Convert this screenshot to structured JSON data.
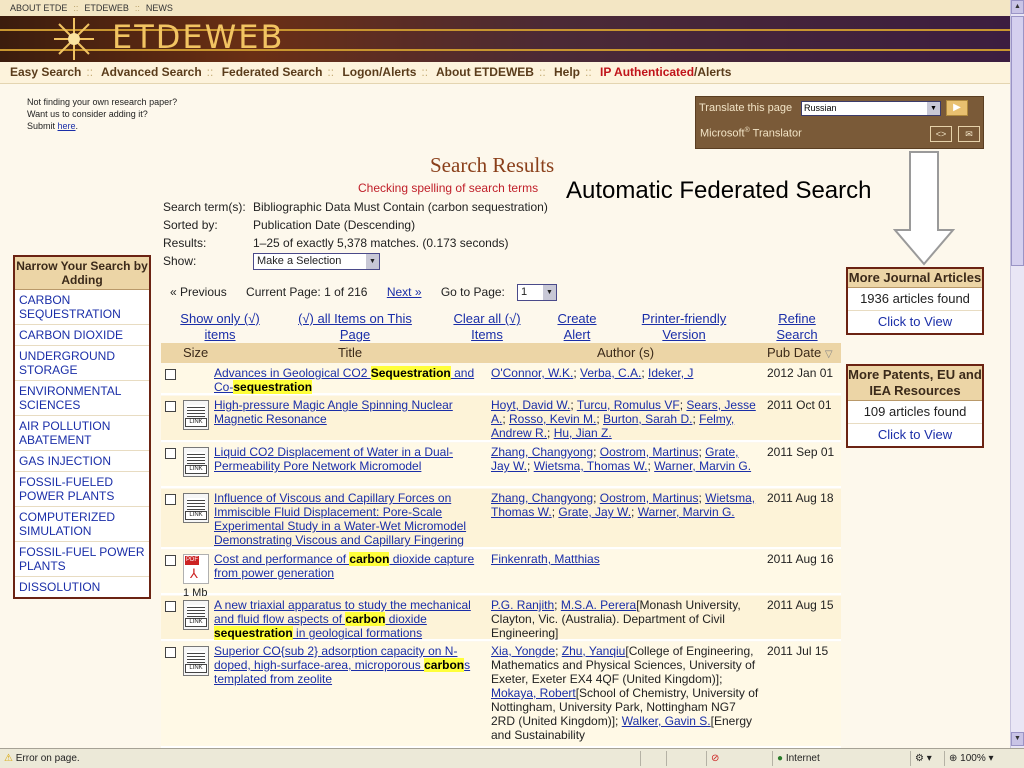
{
  "top_links": [
    "ABOUT ETDE",
    "ETDEWEB",
    "NEWS"
  ],
  "logo": "ETDEWEB",
  "nav": {
    "items": [
      "Easy Search",
      "Advanced Search",
      "Federated Search",
      "Logon/Alerts",
      "About ETDEWEB",
      "Help"
    ],
    "ip_prefix": "IP Authenticated",
    "ip_suffix": "/Alerts"
  },
  "note": {
    "line1": "Not finding your own research paper?",
    "line2": "Want us to consider adding it?",
    "line3_prefix": "Submit ",
    "line3_link": "here",
    "line3_suffix": "."
  },
  "translator": {
    "label": "Translate this page",
    "language": "Russian",
    "provider": "Microsoft",
    "provider_mark": "®",
    "provider_suffix": " Translator",
    "code_icon": "<>",
    "mail_icon": "✉"
  },
  "results_header": {
    "title": "Search Results",
    "spelling": "Checking spelling of search terms",
    "annotation": "Automatic Federated Search"
  },
  "meta": {
    "term_label": "Search term(s):",
    "term_value": "Bibliographic Data Must Contain (carbon sequestration)",
    "sort_label": "Sorted by:",
    "sort_value": "Publication Date (Descending)",
    "results_label": "Results:",
    "results_value": "1–25 of exactly 5,378 matches. (0.173 seconds)",
    "show_label": "Show:",
    "show_value": "Make a Selection"
  },
  "pager": {
    "previous": "« Previous",
    "current": "Current Page: 1 of 216",
    "next": "Next »",
    "goto_label": "Go to Page:",
    "goto_value": "1"
  },
  "actions": {
    "show_only_1": "Show only (√)",
    "show_only_2": "items",
    "all_items_1": "(√) all Items on This",
    "all_items_2": "Page",
    "clear_1": "Clear all (√)",
    "clear_2": "Items",
    "alert_1": "Create",
    "alert_2": "Alert",
    "print_1": "Printer-friendly",
    "print_2": "Version",
    "refine_1": "Refine",
    "refine_2": "Search"
  },
  "table_headers": {
    "size": "Size",
    "title": "Title",
    "author": "Author (s)",
    "date": "Pub Date",
    "sort_icon": "▽"
  },
  "rows": [
    {
      "title_parts": [
        "Advances in Geological CO2 ",
        "Sequestration",
        " and Co-",
        "sequestration"
      ],
      "authors": [
        "O'Connor, W.K.",
        "; ",
        "Verba, C.A.",
        "; ",
        "Ideker, J"
      ],
      "date": "2012 Jan 01"
    },
    {
      "title": "High-pressure Magic Angle Spinning Nuclear Magnetic Resonance",
      "authors": [
        "Hoyt, David W.",
        "; ",
        "Turcu, Romulus VF",
        "; ",
        "Sears, Jesse A.",
        "; ",
        "Rosso, Kevin M.",
        "; ",
        "Burton, Sarah D.",
        "; ",
        "Felmy, Andrew R.",
        "; ",
        "Hu, Jian Z."
      ],
      "date": "2011 Oct 01"
    },
    {
      "title": "Liquid CO2 Displacement of Water in a Dual-Permeability Pore Network Micromodel",
      "authors": [
        "Zhang, Changyong",
        "; ",
        "Oostrom, Martinus",
        "; ",
        "Grate, Jay W.",
        "; ",
        "Wietsma, Thomas W.",
        "; ",
        "Warner, Marvin G."
      ],
      "date": "2011 Sep 01"
    },
    {
      "title": "Influence of Viscous and Capillary Forces on Immiscible Fluid Displacement: Pore-Scale Experimental Study in a Water-Wet Micromodel Demonstrating Viscous and Capillary Fingering",
      "authors": [
        "Zhang, Changyong",
        "; ",
        "Oostrom, Martinus",
        "; ",
        "Wietsma, Thomas W.",
        "; ",
        "Grate, Jay W.",
        "; ",
        "Warner, Marvin G."
      ],
      "date": "2011 Aug 18"
    },
    {
      "title_parts": [
        "Cost and performance of ",
        "carbon",
        " dioxide capture from power generation"
      ],
      "authors": [
        "Finkenrath, Matthias"
      ],
      "date": "2011 Aug 16",
      "size": "1 Mb"
    },
    {
      "title_parts": [
        "A new triaxial apparatus to study the mechanical and fluid flow aspects of ",
        "carbon",
        " dioxide ",
        "sequestration",
        " in geological formations"
      ],
      "author_link_1": "P.G. Ranjith",
      "author_sep": "; ",
      "author_link_2": "M.S.A. Perera",
      "author_affil": "[Monash University, Clayton, Vic. (Australia). Department of Civil Engineering]",
      "date": "2011 Aug 15"
    },
    {
      "title_parts": [
        "Superior CO{sub 2} adsorption capacity on N-doped, high-surface-area, microporous ",
        "carbon",
        "s templated from zeolite"
      ],
      "author_link_1": "Xia, Yongde",
      "author_sep": "; ",
      "author_link_2": "Zhu, Yanqiu",
      "author_affil": "[College of Engineering, Mathematics and Physical Sciences, University of Exeter, Exeter EX4 4QF (United Kingdom)]; ",
      "author_link_3": "Mokaya, Robert",
      "author_affil_2": "[School of Chemistry, University of Nottingham, University Park, Nottingham NG7 2RD (United Kingdom)]; ",
      "author_link_4": "Walker, Gavin S.",
      "author_affil_3": "[Energy and Sustainability",
      "date": "2011 Jul 15"
    }
  ],
  "narrow": {
    "header": "Narrow Your Search by Adding",
    "items": [
      "CARBON SEQUESTRATION",
      "CARBON DIOXIDE",
      "UNDERGROUND STORAGE",
      "ENVIRONMENTAL SCIENCES",
      "AIR POLLUTION ABATEMENT",
      "GAS INJECTION",
      "FOSSIL-FUELED POWER PLANTS",
      "COMPUTERIZED SIMULATION",
      "FOSSIL-FUEL POWER PLANTS",
      "DISSOLUTION"
    ]
  },
  "journal_panel": {
    "header": "More Journal Articles",
    "count": "1936 articles found",
    "link": "Click to View"
  },
  "patents_panel": {
    "header": "More Patents, EU and IEA Resources",
    "count": "109 articles found",
    "link": "Click to View"
  },
  "file_icon_label": "LINK",
  "pdf_label": "PDF",
  "status": {
    "message": "Error on page.",
    "zone": "Internet",
    "zoom": "100%"
  },
  "colors": {
    "accent": "#6b2313",
    "link": "#1a2ea8",
    "highlight": "#ffff3a",
    "header_bg": "#ecd5a6"
  }
}
